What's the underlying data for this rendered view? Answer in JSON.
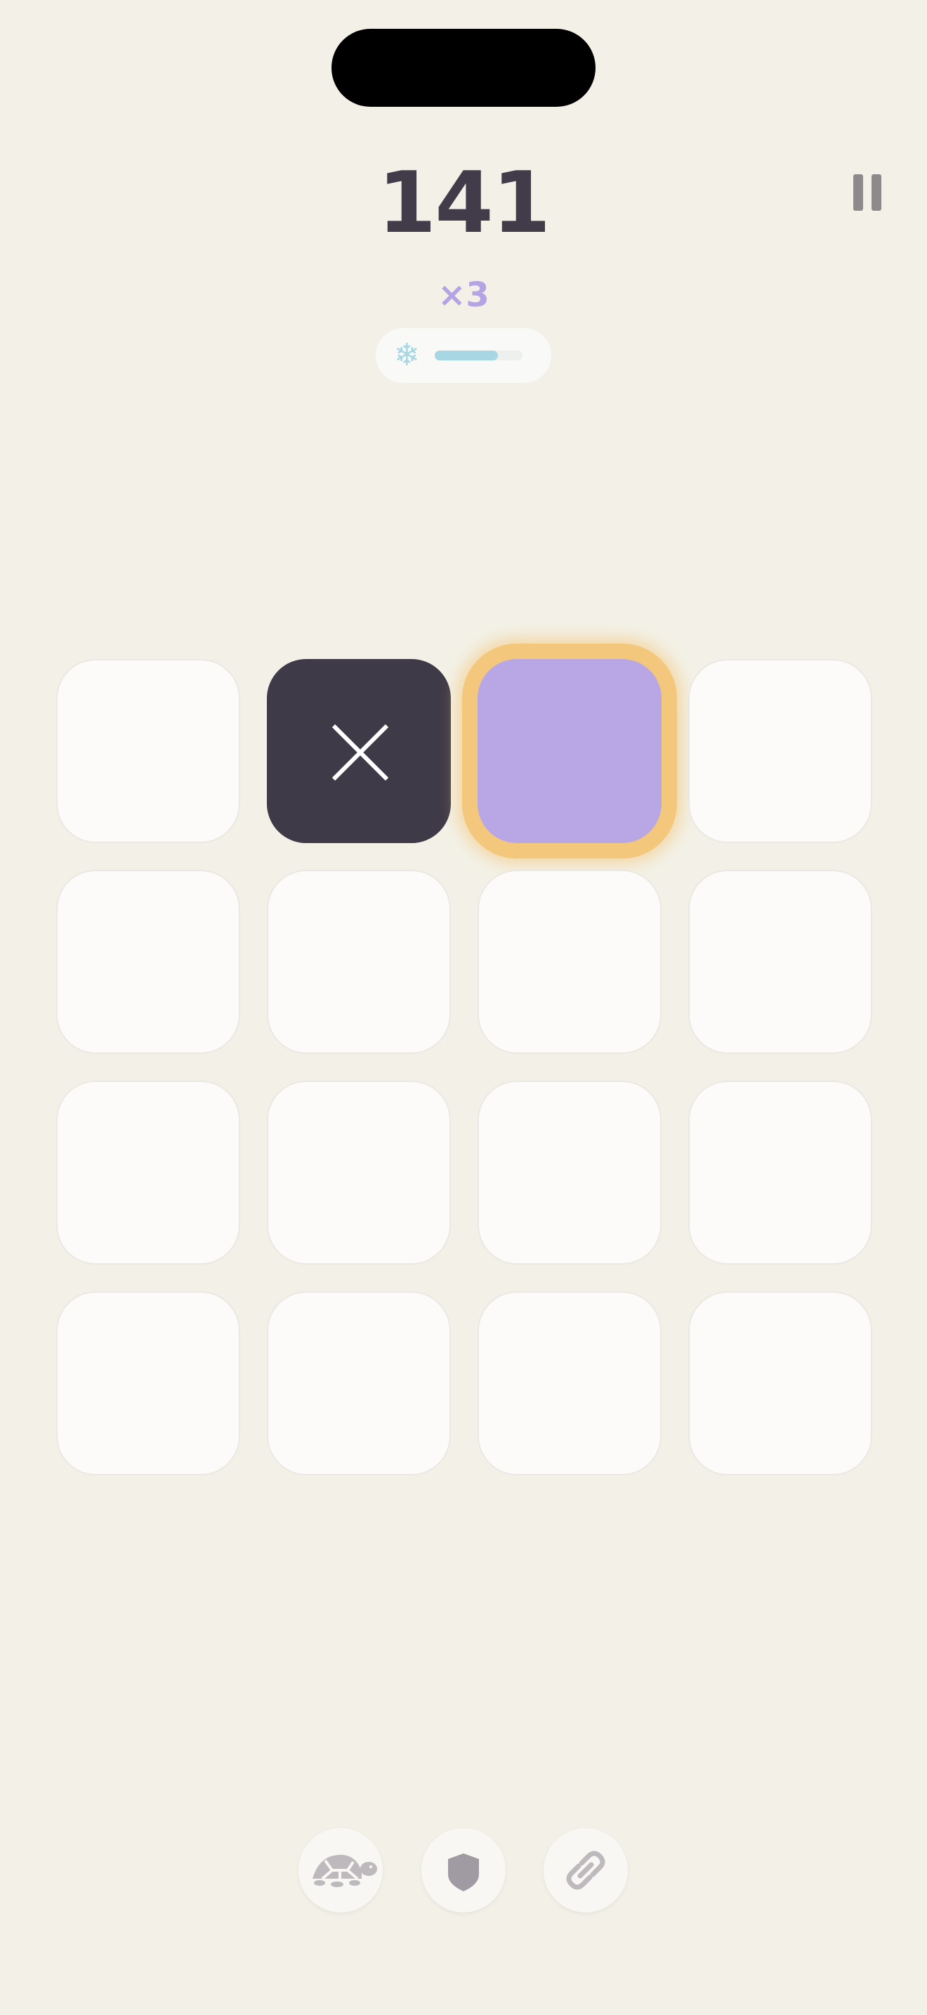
{
  "score": "141",
  "multiplier": "×3",
  "freeze": {
    "icon": "❄",
    "level": 0.72
  },
  "grid": {
    "rows": 4,
    "cols": 4,
    "cells": [
      "empty",
      "blocked",
      "target",
      "empty",
      "empty",
      "empty",
      "empty",
      "empty",
      "empty",
      "empty",
      "empty",
      "empty",
      "empty",
      "empty",
      "empty",
      "empty"
    ]
  },
  "powerups": [
    {
      "name": "slow-down",
      "icon": "turtle-icon"
    },
    {
      "name": "shield",
      "icon": "shield-icon"
    },
    {
      "name": "chain",
      "icon": "link-icon"
    }
  ],
  "colors": {
    "background": "#f3f1e7",
    "score": "#413b4a",
    "multiplier": "#b5a4e3",
    "freeze": "#a7d7e2",
    "blocked_tile": "#3f3a48",
    "target_tile": "#b8a7e4",
    "target_glow": "#f3c87c"
  }
}
